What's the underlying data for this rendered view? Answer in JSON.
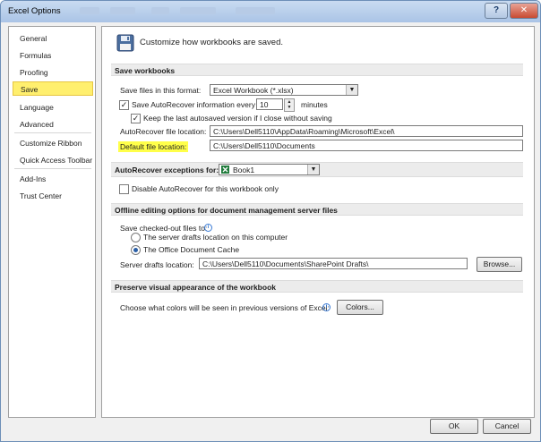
{
  "window": {
    "title": "Excel Options",
    "help_glyph": "?",
    "close_glyph": "✕"
  },
  "nav": {
    "group1": [
      "General",
      "Formulas",
      "Proofing",
      "Save",
      "Language",
      "Advanced"
    ],
    "group2": [
      "Customize Ribbon",
      "Quick Access Toolbar"
    ],
    "group3": [
      "Add-Ins",
      "Trust Center"
    ],
    "selected": "Save"
  },
  "header": {
    "text": "Customize how workbooks are saved."
  },
  "save_workbooks": {
    "section": "Save workbooks",
    "format_label": "Save files in this format:",
    "format_value": "Excel Workbook (*.xlsx)",
    "autorecover_label": "Save AutoRecover information every",
    "autorecover_minutes": "10",
    "minutes_label": "minutes",
    "keep_last_label": "Keep the last autosaved version if I close without saving",
    "ar_location_label": "AutoRecover file location:",
    "ar_location_value": "C:\\Users\\Dell5110\\AppData\\Roaming\\Microsoft\\Excel\\",
    "default_location_label": "Default file location:",
    "default_location_value": "C:\\Users\\Dell5110\\Documents"
  },
  "exceptions": {
    "label": "AutoRecover exceptions for:",
    "workbook": "Book1",
    "disable_label": "Disable AutoRecover for this workbook only"
  },
  "offline": {
    "section": "Offline editing options for document management server files",
    "checked_out_label": "Save checked-out files to:",
    "server_drafts_option": "The server drafts location on this computer",
    "office_cache_option": "The Office Document Cache",
    "server_drafts_label": "Server drafts location:",
    "server_drafts_value": "C:\\Users\\Dell5110\\Documents\\SharePoint Drafts\\",
    "browse_label": "Browse..."
  },
  "preserve": {
    "section": "Preserve visual appearance of the workbook",
    "colors_text": "Choose what colors will be seen in previous versions of Excel:",
    "colors_button": "Colors..."
  },
  "footer": {
    "ok": "OK",
    "cancel": "Cancel"
  },
  "colors": {
    "selected_nav": "#ffef6e",
    "highlight": "#ffff4a",
    "titlebar": "#b7cde9"
  }
}
